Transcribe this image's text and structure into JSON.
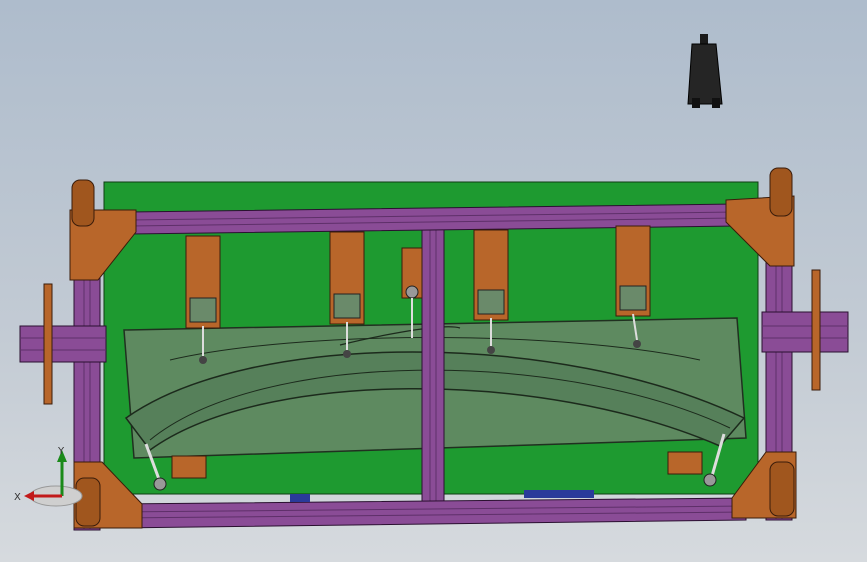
{
  "viewport": {
    "background_top": "#aebccc",
    "background_bottom": "#d6dade"
  },
  "model": {
    "frame_color": "#8a4c96",
    "plate_color": "#1e9a30",
    "window_color": "#5e8a60",
    "bracket_color": "#b8662a",
    "part_outline_color": "#1c2a1c"
  },
  "clamps": {
    "count_top": 5,
    "count_bottom": 2
  },
  "triad": {
    "x_label": "X",
    "y_label": "Y",
    "icon": "axis-triad-icon"
  }
}
